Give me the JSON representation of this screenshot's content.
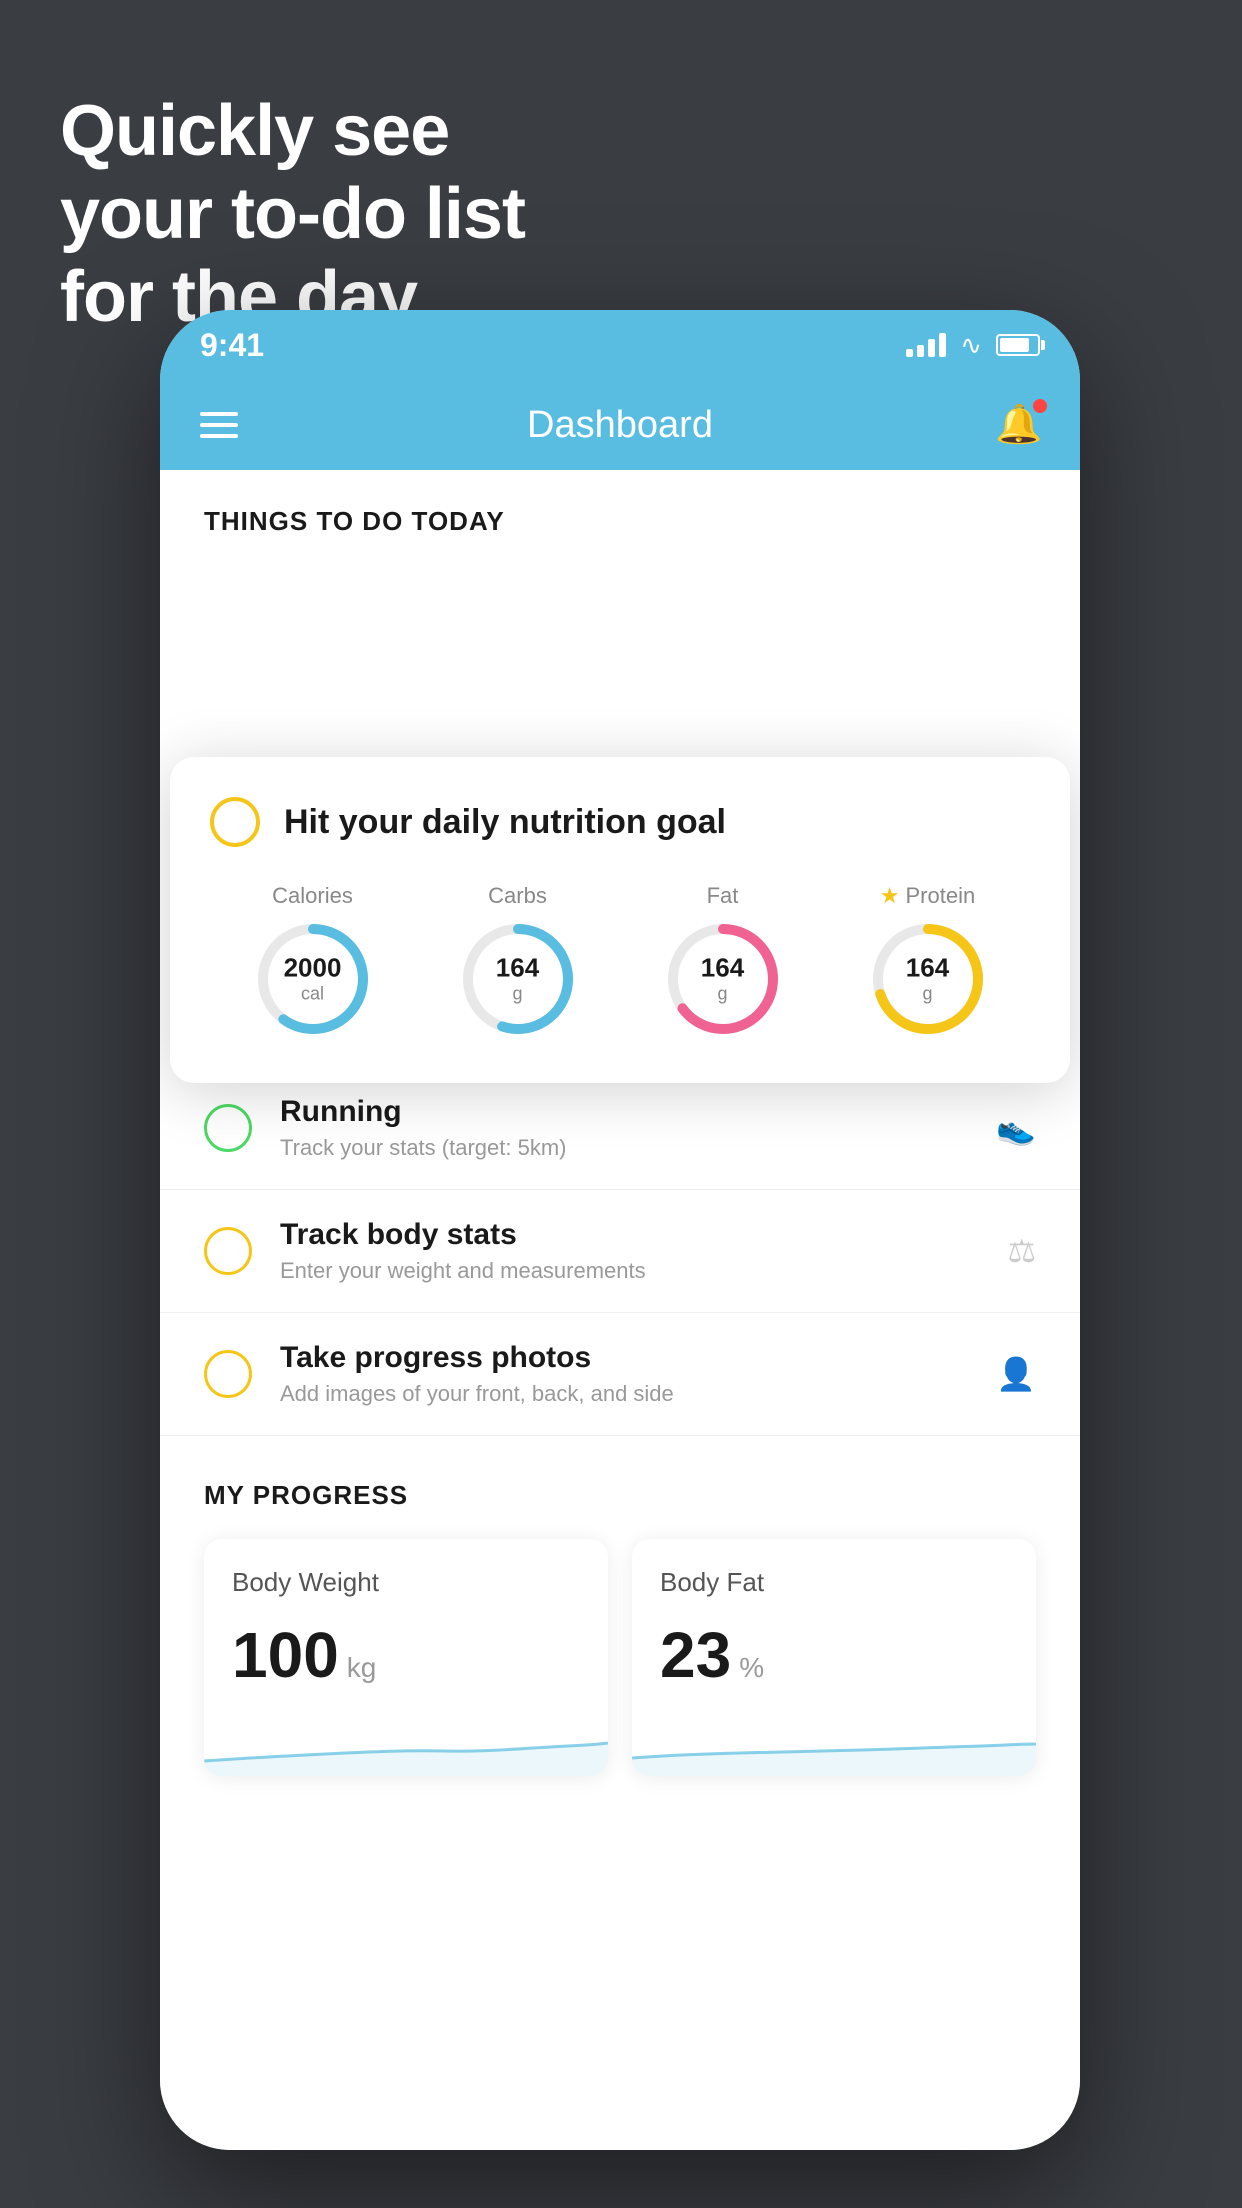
{
  "headline": {
    "line1": "Quickly see",
    "line2": "your to-do list",
    "line3": "for the day."
  },
  "status_bar": {
    "time": "9:41"
  },
  "header": {
    "title": "Dashboard"
  },
  "things_section": {
    "label": "THINGS TO DO TODAY"
  },
  "floating_card": {
    "title": "Hit your daily nutrition goal",
    "nutrition": [
      {
        "label": "Calories",
        "value": "2000",
        "unit": "cal",
        "color": "#58bde0",
        "percent": 60,
        "starred": false
      },
      {
        "label": "Carbs",
        "value": "164",
        "unit": "g",
        "color": "#58bde0",
        "percent": 55,
        "starred": false
      },
      {
        "label": "Fat",
        "value": "164",
        "unit": "g",
        "color": "#f06292",
        "percent": 65,
        "starred": false
      },
      {
        "label": "Protein",
        "value": "164",
        "unit": "g",
        "color": "#f5c518",
        "percent": 70,
        "starred": true
      }
    ]
  },
  "todo_items": [
    {
      "title": "Running",
      "subtitle": "Track your stats (target: 5km)",
      "circle_color": "green",
      "icon": "shoe"
    },
    {
      "title": "Track body stats",
      "subtitle": "Enter your weight and measurements",
      "circle_color": "yellow",
      "icon": "scale"
    },
    {
      "title": "Take progress photos",
      "subtitle": "Add images of your front, back, and side",
      "circle_color": "yellow",
      "icon": "person"
    }
  ],
  "progress_section": {
    "label": "MY PROGRESS",
    "cards": [
      {
        "title": "Body Weight",
        "value": "100",
        "unit": "kg"
      },
      {
        "title": "Body Fat",
        "value": "23",
        "unit": "%"
      }
    ]
  },
  "colors": {
    "header_bg": "#58bde0",
    "background": "#3a3d42",
    "card_bg": "#ffffff",
    "accent_blue": "#58bde0",
    "accent_yellow": "#f5c518",
    "accent_green": "#4cd964",
    "accent_pink": "#f06292"
  }
}
